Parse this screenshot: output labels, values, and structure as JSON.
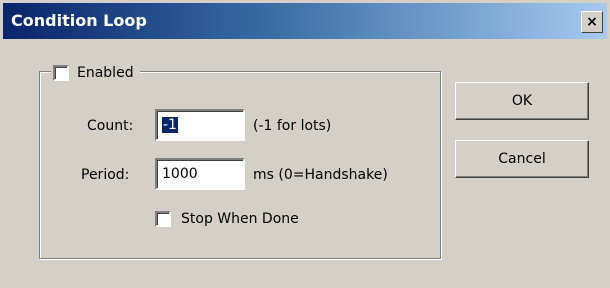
{
  "window": {
    "title": "Condition Loop",
    "close_glyph": "×"
  },
  "group": {
    "enabled_label": "Enabled",
    "enabled_checked": false
  },
  "count": {
    "label": "Count:",
    "value": "-1",
    "hint": "(-1 for lots)"
  },
  "period": {
    "label": "Period:",
    "value": "1000",
    "hint": "ms (0=Handshake)"
  },
  "stop": {
    "label": "Stop When Done",
    "checked": false
  },
  "buttons": {
    "ok": "OK",
    "cancel": "Cancel"
  }
}
